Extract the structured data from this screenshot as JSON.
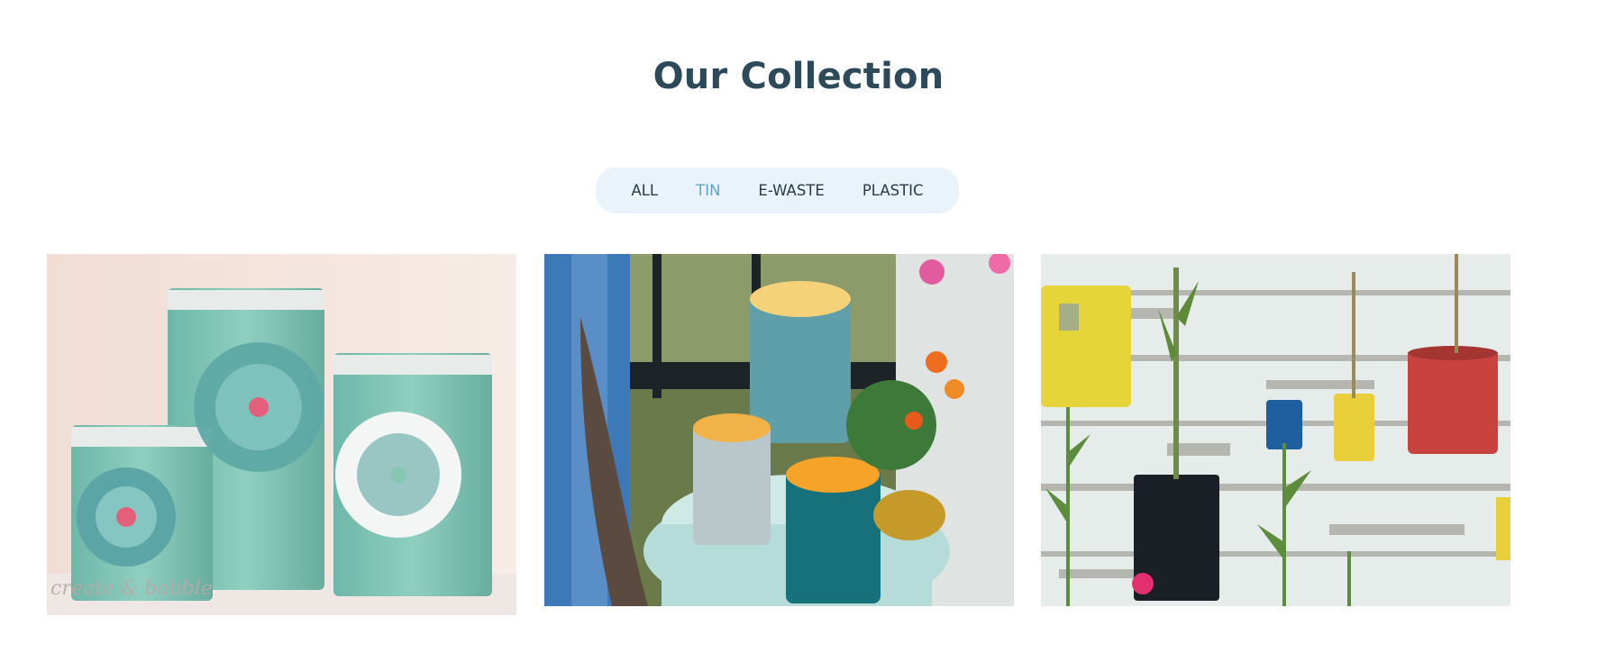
{
  "section": {
    "title": "Our Collection"
  },
  "filters": [
    {
      "label": "ALL",
      "active": false
    },
    {
      "label": "TIN",
      "active": true
    },
    {
      "label": "E-WASTE",
      "active": false
    },
    {
      "label": "PLASTIC",
      "active": false
    }
  ],
  "gallery": {
    "items": [
      {
        "watermark": "create & babble"
      },
      {},
      {}
    ]
  },
  "colors": {
    "title": "#2c4a5a",
    "filter_bar": "#eaf3fa",
    "filter_text": "#273c48",
    "filter_active": "#5aa6cc"
  }
}
